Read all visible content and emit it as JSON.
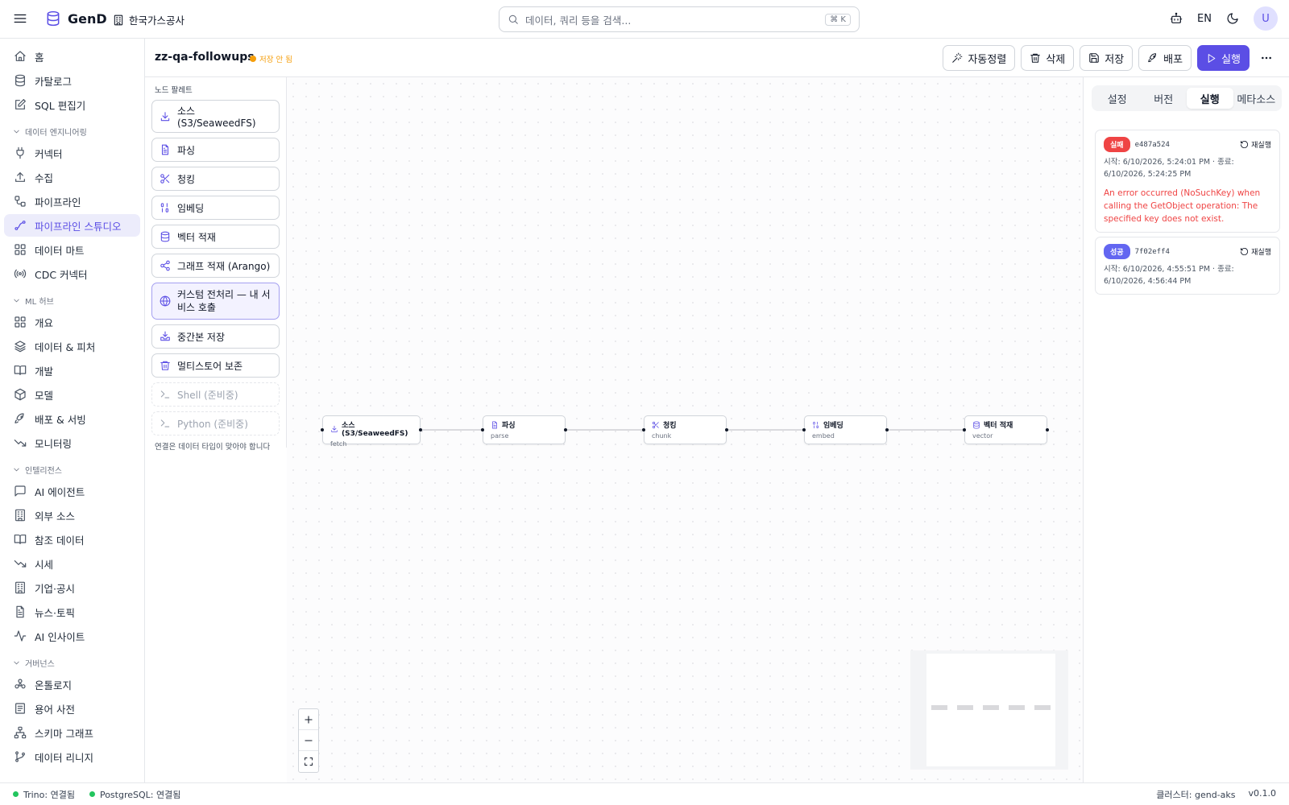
{
  "topbar": {
    "brand": "GenD",
    "org": "한국가스공사",
    "search_placeholder": "데이터, 쿼리 등을 검색...",
    "search_shortcut": "⌘ K",
    "lang": "EN",
    "avatar": "U"
  },
  "sidebar": {
    "top": [
      {
        "label": "홈",
        "icon": "home-icon"
      },
      {
        "label": "카탈로그",
        "icon": "database-icon"
      },
      {
        "label": "SQL 편집기",
        "icon": "edit-icon"
      }
    ],
    "sections": [
      {
        "title": "데이터 엔지니어링",
        "items": [
          {
            "label": "커넥터",
            "icon": "plug-icon"
          },
          {
            "label": "수집",
            "icon": "upload-icon"
          },
          {
            "label": "파이프라인",
            "icon": "workflow-icon"
          },
          {
            "label": "파이프라인 스튜디오",
            "icon": "studio-icon",
            "active": true
          },
          {
            "label": "데이터 마트",
            "icon": "grid-icon"
          },
          {
            "label": "CDC 커넥터",
            "icon": "radio-icon"
          }
        ]
      },
      {
        "title": "ML 허브",
        "items": [
          {
            "label": "개요",
            "icon": "grid-icon"
          },
          {
            "label": "데이터 & 피처",
            "icon": "layers-icon"
          },
          {
            "label": "개발",
            "icon": "book-icon"
          },
          {
            "label": "모델",
            "icon": "box-icon"
          },
          {
            "label": "배포 & 서빙",
            "icon": "rocket-icon"
          },
          {
            "label": "모니터링",
            "icon": "trend-icon"
          }
        ]
      },
      {
        "title": "인텔리전스",
        "items": [
          {
            "label": "AI 에이전트",
            "icon": "chat-icon"
          },
          {
            "label": "외부 소스",
            "icon": "building-icon"
          },
          {
            "label": "참조 데이터",
            "icon": "book-icon"
          },
          {
            "label": "시세",
            "icon": "trend-icon"
          },
          {
            "label": "기업·공시",
            "icon": "building-icon"
          },
          {
            "label": "뉴스·토픽",
            "icon": "file-icon"
          },
          {
            "label": "AI 인사이트",
            "icon": "activity-icon"
          }
        ]
      },
      {
        "title": "거버넌스",
        "items": [
          {
            "label": "온톨로지",
            "icon": "ontology-icon"
          },
          {
            "label": "용어 사전",
            "icon": "list-icon"
          },
          {
            "label": "스키마 그래프",
            "icon": "network-icon"
          },
          {
            "label": "데이터 리니지",
            "icon": "branch-icon"
          }
        ]
      }
    ]
  },
  "editor": {
    "title": "zz-qa-followups",
    "status": "저장 안 됨",
    "actions": {
      "auto_arrange": "자동정렬",
      "delete": "삭제",
      "save": "저장",
      "deploy": "배포",
      "run": "실행"
    }
  },
  "palette": {
    "title": "노드 팔레트",
    "items": [
      {
        "label": "소스 (S3/SeaweedFS)",
        "icon": "download-icon"
      },
      {
        "label": "파싱",
        "icon": "file-icon"
      },
      {
        "label": "청킹",
        "icon": "scissors-icon"
      },
      {
        "label": "임베딩",
        "icon": "binary-icon"
      },
      {
        "label": "벡터 적재",
        "icon": "database-icon"
      },
      {
        "label": "그래프 적재 (Arango)",
        "icon": "share-icon"
      },
      {
        "label": "커스텀 전처리 — 내 서비스 호출",
        "icon": "globe-icon"
      },
      {
        "label": "중간본 저장",
        "icon": "save-tray-icon"
      },
      {
        "label": "멀티스토어 보존",
        "icon": "trash-icon"
      },
      {
        "label": "Shell (준비중)",
        "icon": "terminal-icon"
      },
      {
        "label": "Python (준비중)",
        "icon": "terminal-icon"
      }
    ],
    "hint": "연결은 데이터 타입이 맞아야 합니다"
  },
  "nodes": [
    {
      "label": "소스 (S3/SeaweedFS)",
      "kind": "fetch",
      "icon": "download-icon"
    },
    {
      "label": "파싱",
      "kind": "parse",
      "icon": "file-icon"
    },
    {
      "label": "청킹",
      "kind": "chunk",
      "icon": "scissors-icon"
    },
    {
      "label": "임베딩",
      "kind": "embed",
      "icon": "binary-icon"
    },
    {
      "label": "벡터 적재",
      "kind": "vector",
      "icon": "database-icon"
    }
  ],
  "right_panel": {
    "tabs": [
      "설정",
      "버전",
      "실행",
      "메타소스"
    ],
    "active_tab": "실행",
    "runs": [
      {
        "status": "실패",
        "id": "e487a524",
        "rerun": "재실행",
        "time": "시작: 6/10/2026, 5:24:01 PM · 종료: 6/10/2026, 5:24:25 PM",
        "error": "An error occurred (NoSuchKey) when calling the GetObject operation: The specified key does not exist."
      },
      {
        "status": "성공",
        "id": "7f02eff4",
        "rerun": "재실행",
        "time": "시작: 6/10/2026, 4:55:51 PM · 종료: 6/10/2026, 4:56:44 PM"
      }
    ]
  },
  "statusbar": {
    "trino": "Trino: 연결됨",
    "postgres": "PostgreSQL: 연결됨",
    "cluster": "클러스터: gend-aks",
    "version": "v0.1.0"
  },
  "colors": {
    "accent": "#5b4ee5",
    "fail": "#ef4444",
    "success": "#6366f1",
    "warning": "#f59e0b",
    "connected": "#22c55e"
  }
}
